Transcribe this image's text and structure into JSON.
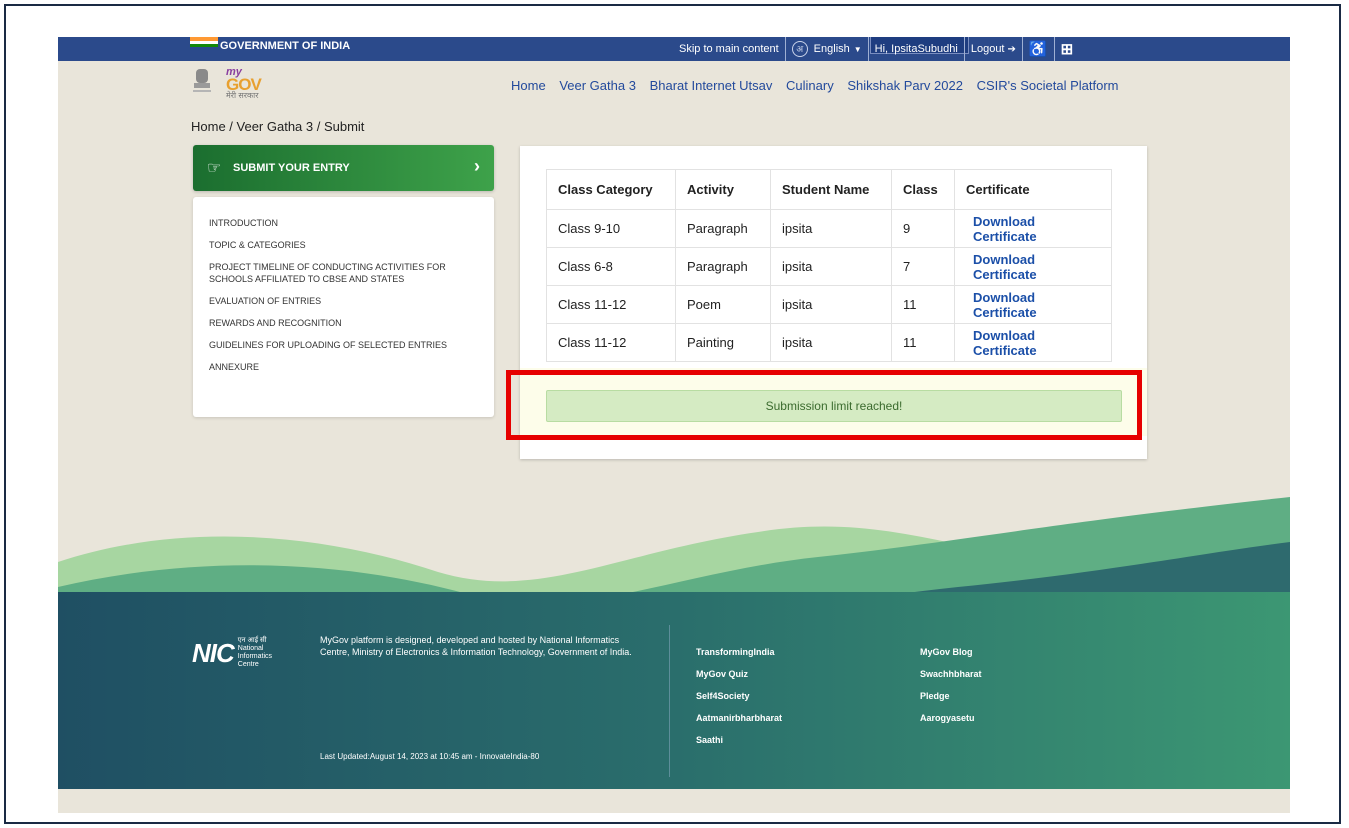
{
  "govbar": {
    "title": "GOVERNMENT OF INDIA",
    "skip": "Skip to main content",
    "language": "English",
    "greeting": "Hi, IpsitaSubudhi",
    "logout": "Logout",
    "logout_glyph": "➔",
    "accessibility_glyph": "♿",
    "sign_glyph": "⊞"
  },
  "nav": {
    "logo_my": "my",
    "logo_gov": "GOV",
    "logo_sub": "मेरी सरकार",
    "links": [
      "Home",
      "Veer Gatha 3",
      "Bharat Internet Utsav",
      "Culinary",
      "Shikshak Parv 2022",
      "CSIR's Societal Platform"
    ]
  },
  "breadcrumb": "Home  /  Veer Gatha 3  /  Submit",
  "sidebar": {
    "submit_label": "SUBMIT YOUR ENTRY",
    "items": [
      "INTRODUCTION",
      "TOPIC & CATEGORIES",
      "PROJECT TIMELINE OF CONDUCTING ACTIVITIES FOR SCHOOLS AFFILIATED TO CBSE AND STATES",
      "EVALUATION OF ENTRIES",
      "REWARDS AND RECOGNITION",
      "GUIDELINES FOR UPLOADING OF SELECTED ENTRIES",
      "ANNEXURE"
    ]
  },
  "table": {
    "headers": [
      "Class Category",
      "Activity",
      "Student Name",
      "Class",
      "Certificate"
    ],
    "rows": [
      [
        "Class 9-10",
        "Paragraph",
        "ipsita",
        "9",
        "Download Certificate"
      ],
      [
        "Class 6-8",
        "Paragraph",
        "ipsita",
        "7",
        "Download Certificate"
      ],
      [
        "Class 11-12",
        "Poem",
        "ipsita",
        "11",
        "Download Certificate"
      ],
      [
        "Class 11-12",
        "Painting",
        "ipsita",
        "11",
        "Download Certificate"
      ]
    ]
  },
  "limit_message": "Submission limit reached!",
  "footer": {
    "nic_letters": "NIC",
    "nic_hindi": "एन आई सी",
    "nic_sub": "National Informatics Centre",
    "description": "MyGov platform is designed, developed and hosted by National Informatics Centre, Ministry of Electronics & Information Technology, Government of India.",
    "last_updated": "Last Updated:August 14, 2023 at 10:45 am - InnovateIndia-80",
    "col1": [
      "TransformingIndia",
      "MyGov Quiz",
      "Self4Society",
      "Aatmanirbharbharat",
      "Saathi"
    ],
    "col2": [
      "MyGov Blog",
      "Swachhbharat",
      "Pledge",
      "Aarogyasetu"
    ]
  },
  "colors": {
    "gov_bar": "#2b4a8b",
    "link": "#234a9c",
    "submit_green": "#2e8b3d",
    "highlight_red": "#e60000",
    "limit_bg": "#d5ebc3"
  }
}
